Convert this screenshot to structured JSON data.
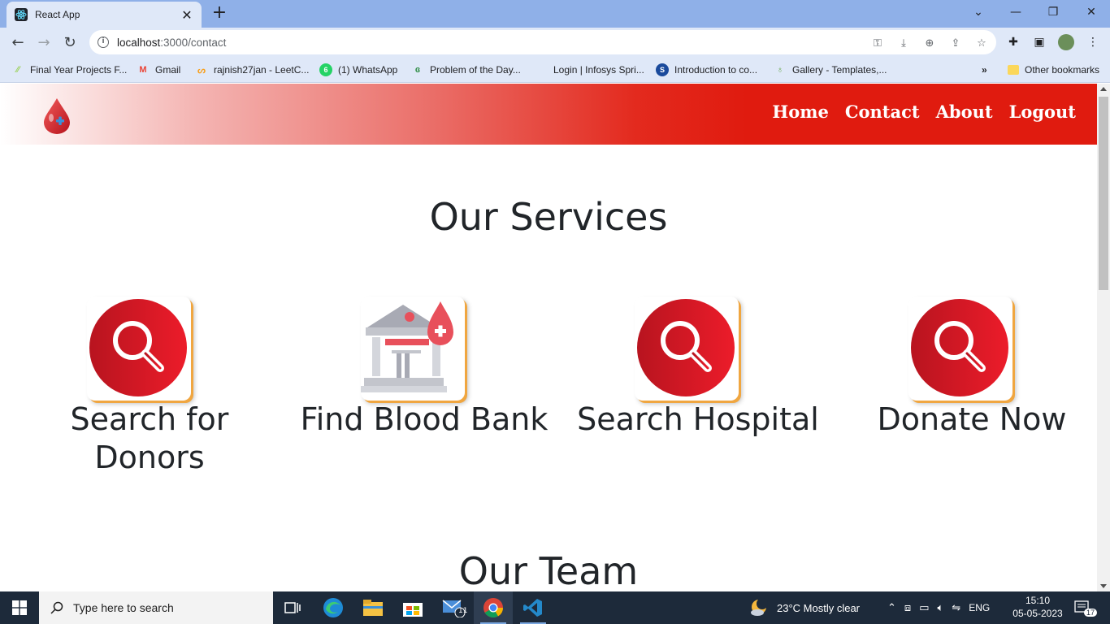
{
  "browser": {
    "tab_title": "React App",
    "url_host": "localhost",
    "url_rest": ":3000/contact",
    "bookmarks": [
      "Final Year Projects F...",
      "Gmail",
      "rajnish27jan - LeetC...",
      "(1) WhatsApp",
      "Problem of the Day...",
      "Login | Infosys Spri...",
      "Introduction to co...",
      "Gallery - Templates,..."
    ],
    "other_bookmarks": "Other bookmarks",
    "more_bookmarks": "»"
  },
  "nav": {
    "links": [
      "Home",
      "Contact",
      "About",
      "Logout"
    ]
  },
  "services": {
    "title": "Our Services",
    "items": [
      {
        "label": "Search for Donors",
        "icon": "search-icon"
      },
      {
        "label": "Find Blood Bank",
        "icon": "blood-bank-icon"
      },
      {
        "label": "Search Hospital",
        "icon": "search-icon"
      },
      {
        "label": "Donate Now",
        "icon": "search-icon"
      }
    ]
  },
  "team": {
    "title": "Our Team"
  },
  "colors": {
    "nav_red": "#e01b0f",
    "icon_red": "#d61c2c",
    "icon_shadow": "#f0a640",
    "text_dark": "#212529"
  },
  "taskbar": {
    "search_placeholder": "Type here to search",
    "weather": "23°C  Mostly clear",
    "language": "ENG",
    "time": "15:10",
    "date": "05-05-2023",
    "mail_badge": "11",
    "notifications": "17"
  }
}
